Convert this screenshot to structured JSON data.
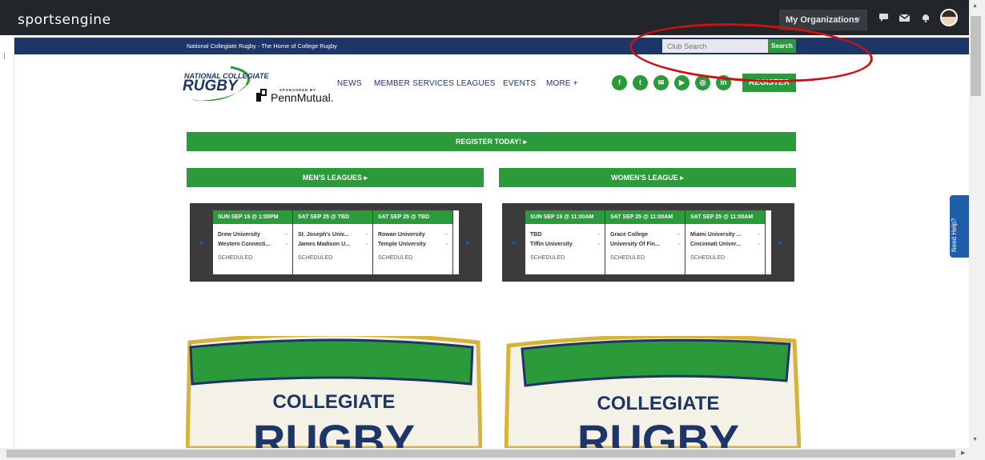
{
  "topbar": {
    "logo": "sportsengine",
    "org_menu_label": "My Organizations",
    "org_menu_chevron": "∨",
    "icons": [
      "chat-icon",
      "mail-icon",
      "bell-icon",
      "avatar"
    ]
  },
  "bluebar": {
    "tagline": "National Collegiate Rugby - The Home of College Rugby",
    "search_placeholder": "Club Search",
    "search_button": "Search"
  },
  "brand": {
    "line1": "NATIONAL COLLEGIATE",
    "line2": "RUGBY",
    "sponsored_by": "SPONSORED BY",
    "sponsor": "PennMutual."
  },
  "nav": {
    "items": [
      "NEWS",
      "MEMBER SERVICES",
      "LEAGUES",
      "EVENTS",
      "MORE +"
    ],
    "social": [
      "facebook-icon",
      "twitter-icon",
      "email-icon",
      "youtube-icon",
      "instagram-icon",
      "linkedin-icon"
    ],
    "social_glyphs": [
      "f",
      "t",
      "✉",
      "▶",
      "◎",
      "in"
    ],
    "register": "REGISTER"
  },
  "banners": {
    "register_today": "REGISTER TODAY! ▸",
    "mens": "MEN'S LEAGUES ▸",
    "womens": "WOMEN'S LEAGUE ▸"
  },
  "mens_games": [
    {
      "header": "SUN SEP 19 @ 1:00PM",
      "team1": "Drew University",
      "team2": "Western Connecti...",
      "status": "SCHEDULED"
    },
    {
      "header": "SAT SEP 25 @ TBD",
      "team1": "St. Joseph's Univ...",
      "team2": "James Madison U...",
      "status": "SCHEDULED"
    },
    {
      "header": "SAT SEP 25 @ TBD",
      "team1": "Rowan University",
      "team2": "Temple University",
      "status": "SCHEDULED"
    }
  ],
  "womens_games": [
    {
      "header": "SUN SEP 19 @ 11:00AM",
      "team1": "TBD",
      "team2": "Tiffin University",
      "status": "SCHEDULED"
    },
    {
      "header": "SAT SEP 25 @ 11:00AM",
      "team1": "Grace College",
      "team2": "University Of Fin...",
      "status": "SCHEDULED"
    },
    {
      "header": "SAT SEP 25 @ 11:00AM",
      "team1": "Miami University ...",
      "team2": "Cincinnati Univer...",
      "status": "SCHEDULED"
    }
  ],
  "score_dash": "-",
  "carousel": {
    "prev": "◂",
    "next": "▸"
  },
  "logos": {
    "word1": "COLLEGIATE",
    "word2": "RUGBY"
  },
  "help_tab": "Need Help?",
  "colors": {
    "green": "#2a9a3a",
    "navy": "#1d3567",
    "topbar": "#22252a",
    "annotation": "#cc1111"
  }
}
